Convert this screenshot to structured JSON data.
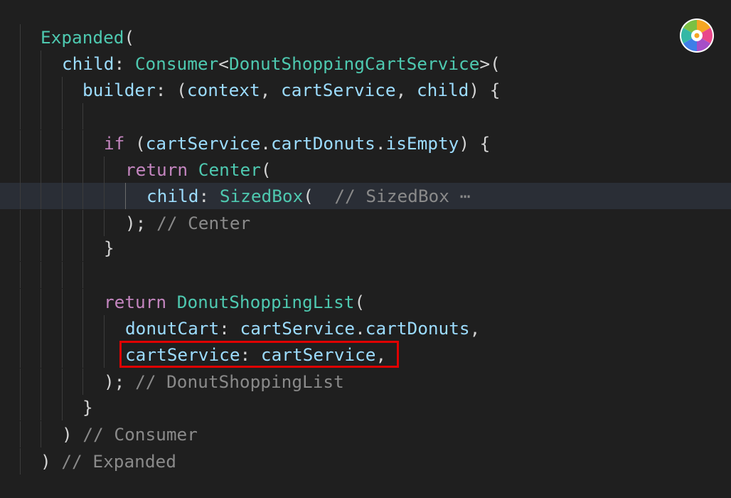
{
  "editor": {
    "lines": [
      {
        "id": "l1",
        "tokens": [
          {
            "c": "t-class",
            "t": "Expanded"
          },
          {
            "c": "t-punct",
            "t": "("
          }
        ]
      },
      {
        "id": "l2",
        "tokens": [
          {
            "c": "t-prop",
            "t": "child"
          },
          {
            "c": "t-punct",
            "t": ": "
          },
          {
            "c": "t-class",
            "t": "Consumer"
          },
          {
            "c": "t-punct",
            "t": "<"
          },
          {
            "c": "t-class",
            "t": "DonutShoppingCartService"
          },
          {
            "c": "t-punct",
            "t": ">("
          }
        ]
      },
      {
        "id": "l3",
        "tokens": [
          {
            "c": "t-prop",
            "t": "builder"
          },
          {
            "c": "t-punct",
            "t": ": ("
          },
          {
            "c": "t-prop",
            "t": "context"
          },
          {
            "c": "t-punct",
            "t": ", "
          },
          {
            "c": "t-prop",
            "t": "cartService"
          },
          {
            "c": "t-punct",
            "t": ", "
          },
          {
            "c": "t-prop",
            "t": "child"
          },
          {
            "c": "t-punct",
            "t": ") {"
          }
        ]
      },
      {
        "id": "l4",
        "tokens": []
      },
      {
        "id": "l5",
        "tokens": [
          {
            "c": "t-kw",
            "t": "if"
          },
          {
            "c": "t-punct",
            "t": " ("
          },
          {
            "c": "t-prop",
            "t": "cartService"
          },
          {
            "c": "t-punct",
            "t": "."
          },
          {
            "c": "t-prop",
            "t": "cartDonuts"
          },
          {
            "c": "t-punct",
            "t": "."
          },
          {
            "c": "t-prop",
            "t": "isEmpty"
          },
          {
            "c": "t-punct",
            "t": ") {"
          }
        ]
      },
      {
        "id": "l6",
        "tokens": [
          {
            "c": "t-kw",
            "t": "return"
          },
          {
            "c": "t-punct",
            "t": " "
          },
          {
            "c": "t-class",
            "t": "Center"
          },
          {
            "c": "t-punct",
            "t": "("
          }
        ]
      },
      {
        "id": "l7",
        "tokens": [
          {
            "c": "t-prop",
            "t": "child"
          },
          {
            "c": "t-punct",
            "t": ": "
          },
          {
            "c": "t-class",
            "t": "SizedBox"
          },
          {
            "c": "t-punct",
            "t": "(  "
          },
          {
            "c": "t-comment",
            "t": "// SizedBox"
          },
          {
            "c": "t-fold",
            "t": " ⋯"
          }
        ]
      },
      {
        "id": "l8",
        "tokens": [
          {
            "c": "t-punct",
            "t": "); "
          },
          {
            "c": "t-comment",
            "t": "// Center"
          }
        ]
      },
      {
        "id": "l9",
        "tokens": [
          {
            "c": "t-punct",
            "t": "}"
          }
        ]
      },
      {
        "id": "l10",
        "tokens": []
      },
      {
        "id": "l11",
        "tokens": [
          {
            "c": "t-kw",
            "t": "return"
          },
          {
            "c": "t-punct",
            "t": " "
          },
          {
            "c": "t-class",
            "t": "DonutShoppingList"
          },
          {
            "c": "t-punct",
            "t": "("
          }
        ]
      },
      {
        "id": "l12",
        "tokens": [
          {
            "c": "t-prop",
            "t": "donutCart"
          },
          {
            "c": "t-punct",
            "t": ": "
          },
          {
            "c": "t-prop",
            "t": "cartService"
          },
          {
            "c": "t-punct",
            "t": "."
          },
          {
            "c": "t-prop",
            "t": "cartDonuts"
          },
          {
            "c": "t-punct",
            "t": ","
          }
        ]
      },
      {
        "id": "l13",
        "tokens": [
          {
            "c": "t-prop",
            "t": "cartService"
          },
          {
            "c": "t-punct",
            "t": ": "
          },
          {
            "c": "t-prop",
            "t": "cartService"
          },
          {
            "c": "t-punct",
            "t": ","
          }
        ]
      },
      {
        "id": "l14",
        "tokens": [
          {
            "c": "t-punct",
            "t": "); "
          },
          {
            "c": "t-comment",
            "t": "// DonutShoppingList"
          }
        ]
      },
      {
        "id": "l15",
        "tokens": [
          {
            "c": "t-punct",
            "t": "}"
          }
        ]
      },
      {
        "id": "l16",
        "tokens": [
          {
            "c": "t-punct",
            "t": ") "
          },
          {
            "c": "t-comment",
            "t": "// Consumer"
          }
        ]
      },
      {
        "id": "l17",
        "tokens": [
          {
            "c": "t-punct",
            "t": ") "
          },
          {
            "c": "t-comment",
            "t": "// Expanded"
          }
        ]
      }
    ]
  },
  "colors": {
    "background": "#1f1f1f",
    "current_line": "#2a2e36",
    "class": "#4ec9b0",
    "property": "#9cdcfe",
    "keyword": "#c586c0",
    "comment": "#8a8a8a",
    "highlight": "#e00000"
  },
  "icons": {
    "color_wheel": "color-wheel-icon"
  }
}
